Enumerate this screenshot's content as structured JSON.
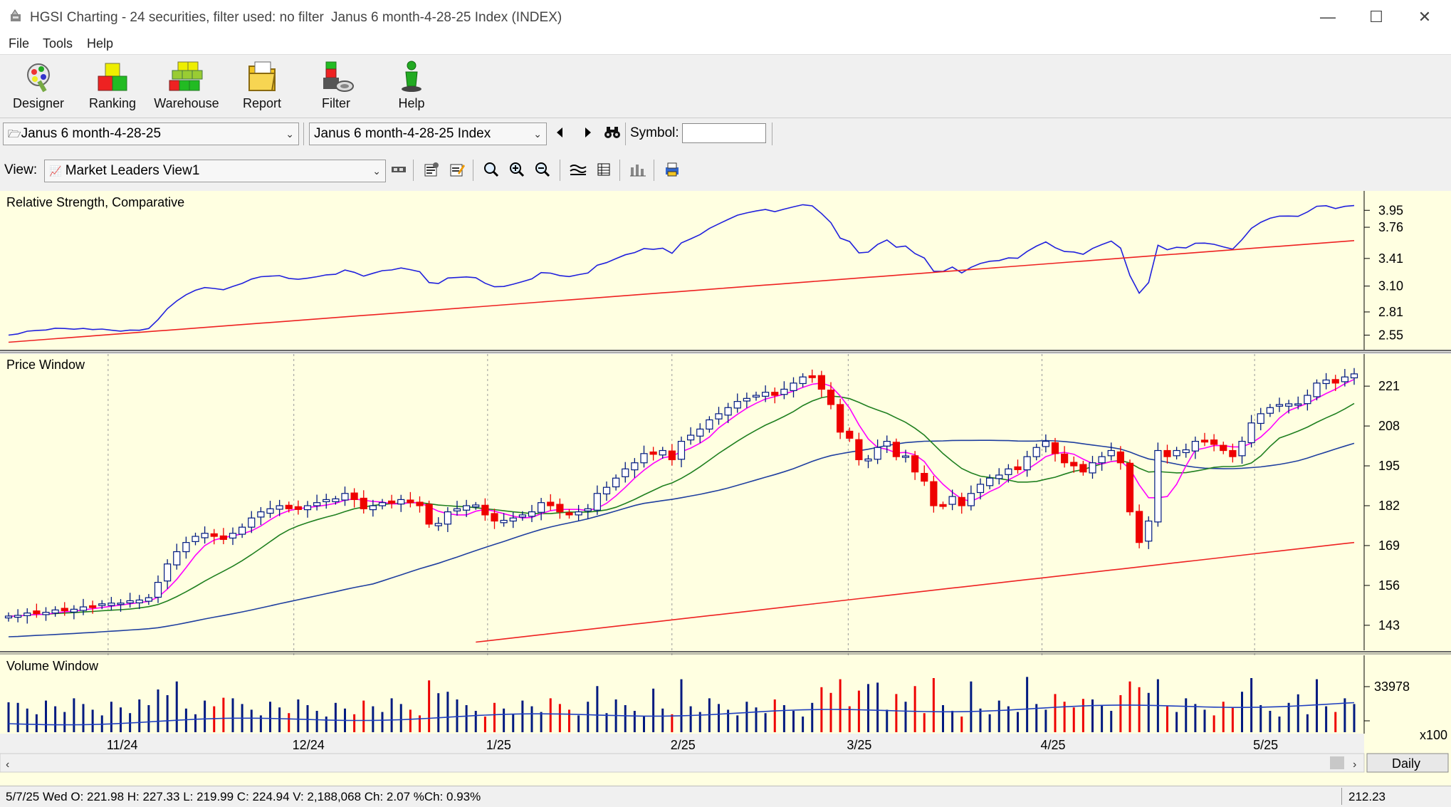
{
  "window": {
    "app_title": "HGSI Charting - 24 securities, filter used: no filter",
    "doc_title": "Janus 6 month-4-28-25 Index (INDEX)",
    "minimize": "—",
    "maximize": "☐",
    "close": "✕"
  },
  "menu": {
    "file": "File",
    "tools": "Tools",
    "help": "Help"
  },
  "toolbar": {
    "designer": "Designer",
    "ranking": "Ranking",
    "warehouse": "Warehouse",
    "report": "Report",
    "filter": "Filter",
    "help": "Help"
  },
  "selectors": {
    "list": "Janus 6 month-4-28-25",
    "security": "Janus 6 month-4-28-25 Index",
    "symbol_label": "Symbol:",
    "symbol_value": ""
  },
  "view": {
    "label": "View:",
    "selected": "Market Leaders View1"
  },
  "panes": {
    "rs_title": "Relative Strength, Comparative",
    "price_title": "Price Window",
    "volume_title": "Volume Window"
  },
  "axes": {
    "rs_ticks": [
      "3.95",
      "3.76",
      "3.41",
      "3.10",
      "2.81",
      "2.55"
    ],
    "price_ticks": [
      "221",
      "208",
      "195",
      "182",
      "169",
      "156",
      "143"
    ],
    "volume_tick": "33978",
    "volume_unit": "x100",
    "date_labels": [
      "11/24",
      "12/24",
      "1/25",
      "2/25",
      "3/25",
      "4/25",
      "5/25"
    ],
    "period": "Daily"
  },
  "status": {
    "quote": "5/7/25 Wed O: 221.98 H: 227.33 L: 219.99 C: 224.94 V: 2,188,068 Ch: 2.07 %Ch: 0.93%",
    "cursor_value": "212.23"
  },
  "colors": {
    "pane_bg": "#ffffe1",
    "up": "#001a80",
    "down": "#ee0000",
    "ma_short": "#ff00ff",
    "ma_mid": "#208020",
    "ma_long": "#1f3f9f",
    "ma_200": "#ee2222",
    "rs_line": "#2020dd",
    "rs_ma": "#ee2222"
  },
  "chart_data": {
    "type": "candlestick",
    "x_start": "2024-11-01",
    "x_end": "2025-05-07",
    "date_ticks": [
      "11/24",
      "12/24",
      "1/25",
      "2/25",
      "3/25",
      "4/25",
      "5/25"
    ],
    "price_axis": {
      "ticks": [
        221,
        208,
        195,
        182,
        169,
        156,
        143
      ],
      "ylim": [
        136,
        228
      ]
    },
    "price_close_approx": [
      146,
      146,
      147,
      147,
      147,
      148,
      148,
      148,
      149,
      149,
      150,
      150,
      150,
      151,
      151,
      152,
      157,
      163,
      167,
      170,
      172,
      173,
      172,
      171,
      173,
      175,
      178,
      180,
      181,
      182,
      181,
      181,
      182,
      183,
      184,
      184,
      186,
      184,
      181,
      182,
      183,
      183,
      184,
      183,
      182,
      176,
      176,
      180,
      181,
      182,
      182,
      179,
      177,
      177,
      178,
      179,
      180,
      183,
      182,
      180,
      179,
      180,
      181,
      186,
      188,
      191,
      194,
      196,
      199,
      199,
      200,
      197,
      203,
      205,
      207,
      210,
      212,
      214,
      216,
      217,
      218,
      219,
      218,
      220,
      222,
      224,
      224,
      220,
      215,
      206,
      204,
      197,
      197,
      201,
      203,
      198,
      198,
      193,
      190,
      182,
      182,
      185,
      182,
      186,
      189,
      191,
      192,
      194,
      194,
      198,
      201,
      203,
      199,
      196,
      195,
      193,
      196,
      198,
      200,
      196,
      180,
      170,
      177,
      200,
      198,
      200,
      200,
      203,
      203,
      202,
      200,
      198,
      203,
      209,
      212,
      214,
      215,
      215,
      215,
      218,
      222,
      223,
      222,
      224,
      225
    ],
    "ma_short_approx_last": 221,
    "ma_mid_approx_last": 214,
    "ma_long_approx_last": 199,
    "ma_200_approx_last": 170,
    "rs_axis": {
      "ticks": [
        3.95,
        3.76,
        3.41,
        3.1,
        2.81,
        2.55
      ],
      "ylim": [
        2.45,
        4.12
      ]
    },
    "volume_axis": {
      "tick": 33978,
      "unit": "x100"
    }
  }
}
